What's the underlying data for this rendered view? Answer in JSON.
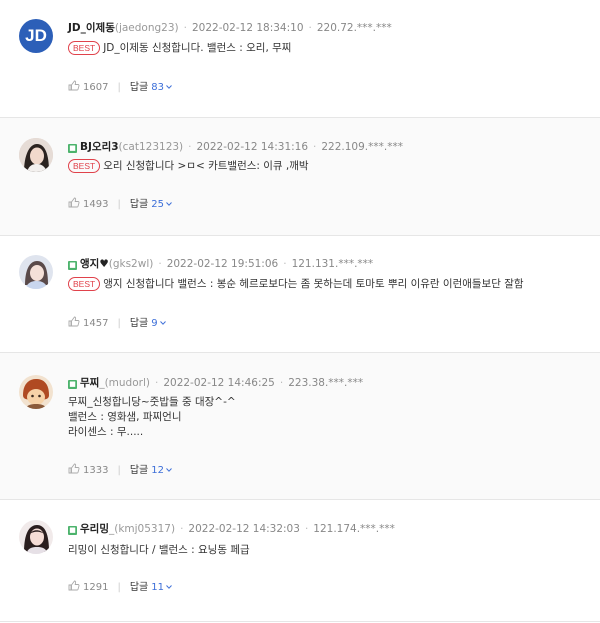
{
  "comments": [
    {
      "nick": "JD_이제동",
      "uid": "(jaedong23)",
      "date": "2022-02-12 18:34:10",
      "ip": "220.72.***.***",
      "best_label": "BEST",
      "lines": [
        "JD_이제동 신청합니다. 밸런스 : 오리, 무찌"
      ],
      "likes": "1607",
      "reply_label": "답글",
      "reply_count": "83",
      "avatar_text": "JD"
    },
    {
      "nick": "BJ오리3",
      "uid": "(cat123123)",
      "date": "2022-02-12 14:31:16",
      "ip": "222.109.***.***",
      "best_label": "BEST",
      "lines": [
        "오리 신청합니다 >ㅁ<  카트밸런스: 이큐 ,깨박"
      ],
      "likes": "1493",
      "reply_label": "답글",
      "reply_count": "25"
    },
    {
      "nick": "앵지♥",
      "uid": "(gks2wl)",
      "date": "2022-02-12 19:51:06",
      "ip": "121.131.***.***",
      "best_label": "BEST",
      "lines": [
        "앵지 신청합니다 밸런스 : 봉순 헤르로보다는 좀 못하는데 토마토 뿌리 이유란 이런애들보단 잘함"
      ],
      "likes": "1457",
      "reply_label": "답글",
      "reply_count": "9"
    },
    {
      "nick": "무찌",
      "uid": "_(mudorl)",
      "date": "2022-02-12 14:46:25",
      "ip": "223.38.***.***",
      "lines": [
        "무찌_신청합니당~줏밥들 중 대장^-^",
        "밸런스 : 영화샘, 파찌언니",
        "라이센스 : 무....."
      ],
      "likes": "1333",
      "reply_label": "답글",
      "reply_count": "12"
    },
    {
      "nick": "우리밍",
      "uid": "_(kmj05317)",
      "date": "2022-02-12 14:32:03",
      "ip": "121.174.***.***",
      "lines": [
        "리밍이 신청합니다  / 밸런스 : 요닝동 페급"
      ],
      "likes": "1291",
      "reply_label": "답글",
      "reply_count": "11"
    }
  ],
  "colors": {
    "best": "#e0424b",
    "reply_count": "#3d6fd8",
    "badge": "#4cb36c",
    "jd_avatar": "#2c5fb8"
  }
}
